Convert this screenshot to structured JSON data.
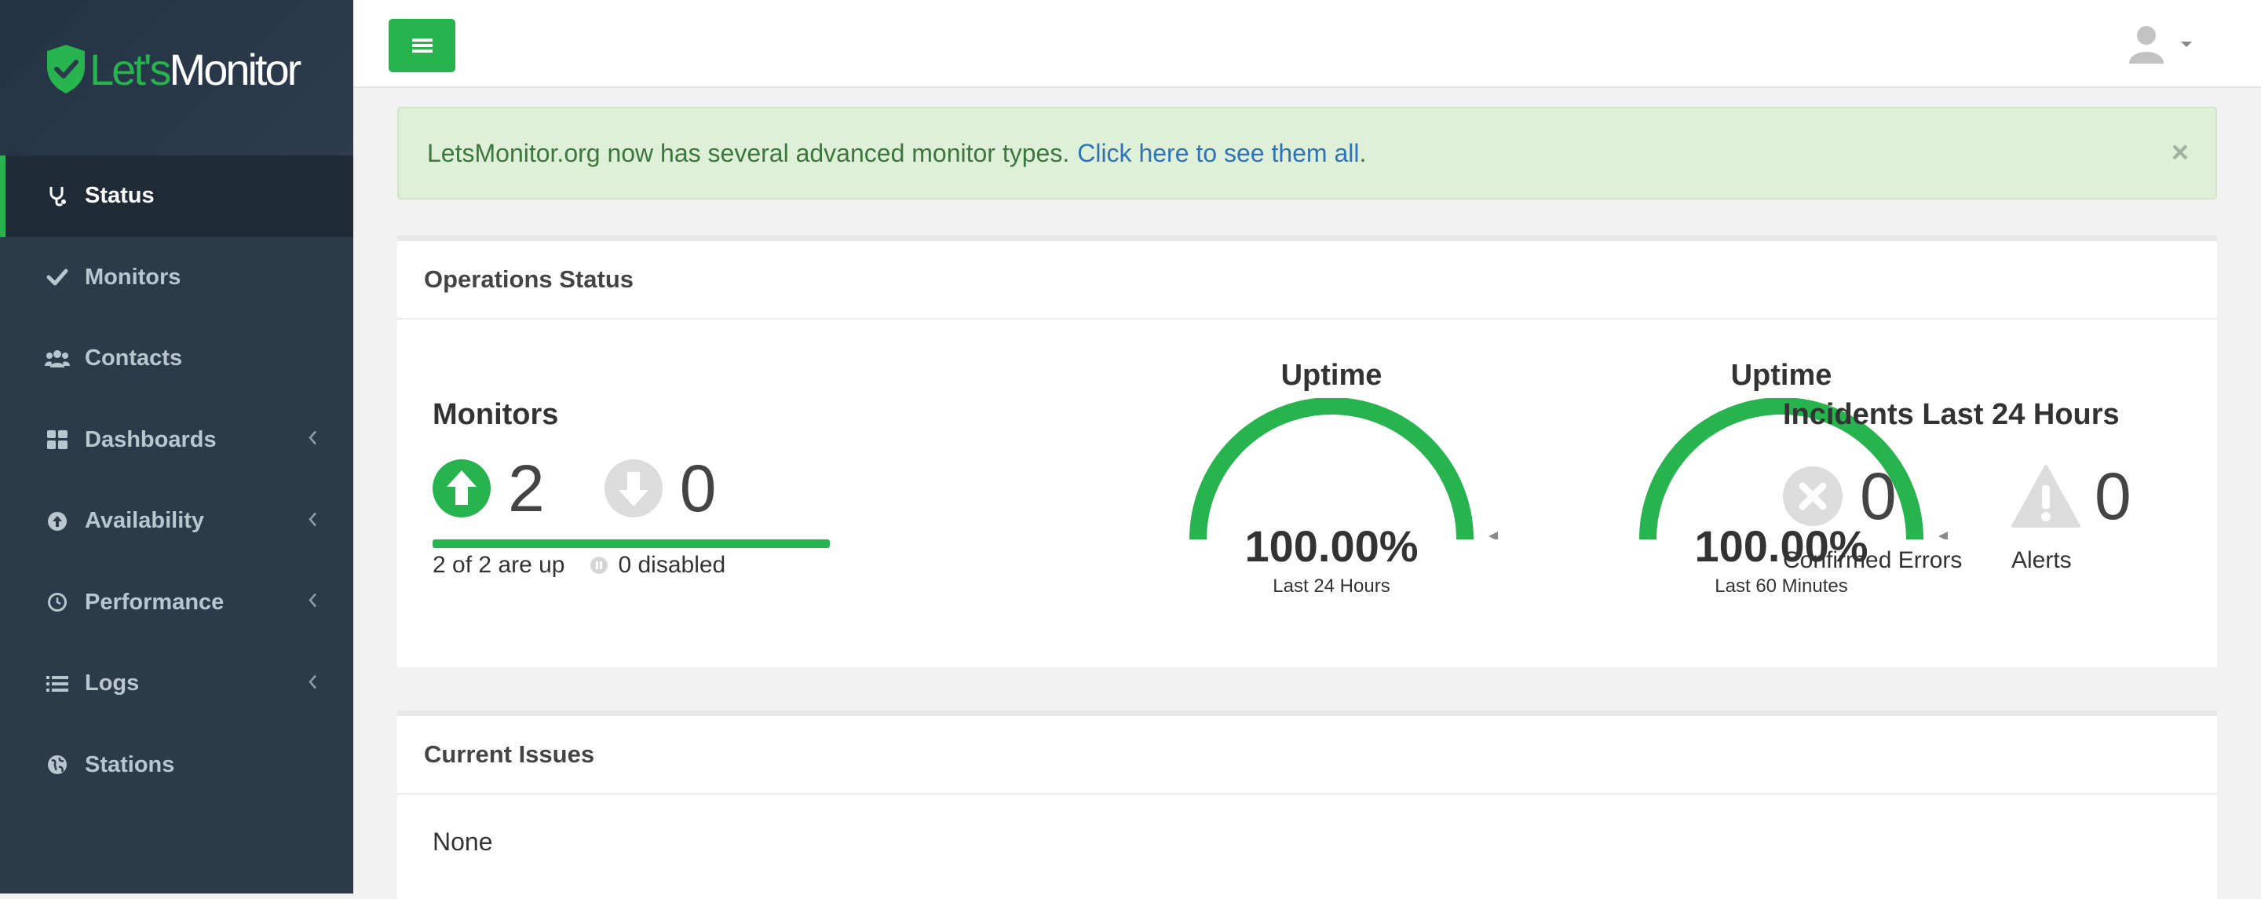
{
  "brand": {
    "logo_text_lets": "Let's",
    "logo_text_monitor": "Monitor"
  },
  "nav": {
    "items": [
      {
        "label": "Status",
        "icon": "stethoscope-icon",
        "active": true
      },
      {
        "label": "Monitors",
        "icon": "check-icon"
      },
      {
        "label": "Contacts",
        "icon": "users-icon"
      },
      {
        "label": "Dashboards",
        "icon": "grid-icon",
        "submenu": true
      },
      {
        "label": "Availability",
        "icon": "arrow-circle-icon",
        "submenu": true
      },
      {
        "label": "Performance",
        "icon": "clock-icon",
        "submenu": true
      },
      {
        "label": "Logs",
        "icon": "list-icon",
        "submenu": true
      },
      {
        "label": "Stations",
        "icon": "globe-icon"
      }
    ]
  },
  "alert": {
    "text": "LetsMonitor.org now has several advanced monitor types.",
    "link_text": "Click here to see them all",
    "suffix": ".",
    "close": "×"
  },
  "operations": {
    "title": "Operations Status",
    "monitors": {
      "title": "Monitors",
      "up_count": "2",
      "down_count": "0",
      "up_summary": "2 of 2 are up",
      "disabled_summary": "0 disabled",
      "up_fraction": 1.0
    },
    "uptime_24h": {
      "title": "Uptime",
      "value": "100.00%",
      "subtitle": "Last 24 Hours",
      "fraction": 1.0
    },
    "uptime_60m": {
      "title": "Uptime",
      "value": "100.00%",
      "subtitle": "Last 60 Minutes",
      "fraction": 1.0
    },
    "incidents": {
      "title": "Incidents Last 24 Hours",
      "confirmed_errors_count": "0",
      "confirmed_errors_label": "Confirmed Errors",
      "alerts_count": "0",
      "alerts_label": "Alerts"
    }
  },
  "issues": {
    "title": "Current Issues",
    "body": "None"
  },
  "colors": {
    "accent": "#27b34e",
    "sidebar": "#2c3b4a",
    "sidebar_active": "#1e2b37",
    "alert_bg": "#dff0d8",
    "link": "#2f72b8"
  }
}
